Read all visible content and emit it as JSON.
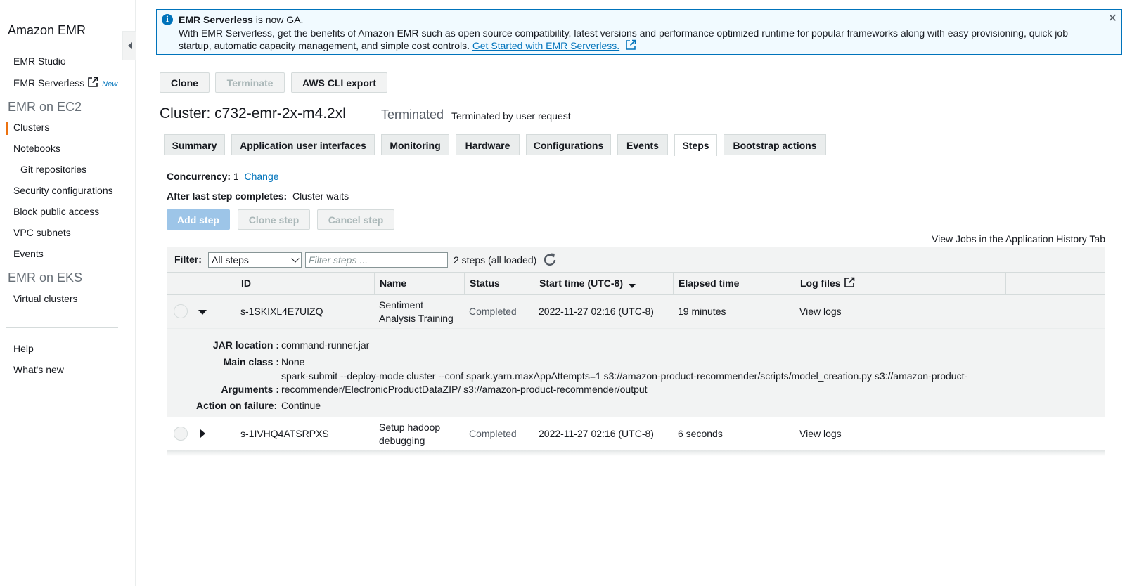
{
  "sidebar": {
    "title": "Amazon EMR",
    "collapse_icon": "caret-left-icon",
    "top_items": [
      {
        "label": "EMR Studio"
      },
      {
        "label": "EMR Serverless",
        "badge": "New"
      }
    ],
    "sections": [
      {
        "label": "EMR on EC2"
      },
      {
        "label": "EMR on EKS"
      }
    ],
    "ec2_items": [
      {
        "label": "Clusters",
        "active": true
      },
      {
        "label": "Notebooks"
      },
      {
        "label": "Git repositories"
      },
      {
        "label": "Security configurations"
      },
      {
        "label": "Block public access"
      },
      {
        "label": "VPC subnets"
      },
      {
        "label": "Events"
      }
    ],
    "eks_items": [
      {
        "label": "Virtual clusters"
      }
    ],
    "bottom_items": [
      {
        "label": "Help"
      },
      {
        "label": "What's new"
      }
    ],
    "active_color": "#ec7211"
  },
  "banner": {
    "title": "EMR Serverless",
    "title_suffix": " is now GA.",
    "body": "With EMR Serverless, get the benefits of Amazon EMR such as open source compatibility, latest versions and performance optimized runtime for popular frameworks along with easy provisioning, quick job startup, automatic capacity management, and simple cost controls.",
    "link_text": "Get Started with EMR Serverless.",
    "close": "✕",
    "info_icon_text": "i"
  },
  "actions": {
    "clone": "Clone",
    "terminate": "Terminate",
    "cli_export": "AWS CLI export"
  },
  "cluster": {
    "title": "Cluster: c732-emr-2x-m4.2xl",
    "state": "Terminated",
    "state_reason": "Terminated by user request"
  },
  "tabs": [
    {
      "label": "Summary"
    },
    {
      "label": "Application user interfaces"
    },
    {
      "label": "Monitoring"
    },
    {
      "label": "Hardware"
    },
    {
      "label": "Configurations"
    },
    {
      "label": "Events"
    },
    {
      "label": "Steps",
      "active": true
    },
    {
      "label": "Bootstrap actions"
    }
  ],
  "steps": {
    "concurrency_label": "Concurrency:",
    "concurrency_value": "1",
    "change_link": "Change",
    "after_label": "After last step completes:",
    "after_value": "Cluster waits",
    "add_step": "Add step",
    "clone_step": "Clone step",
    "cancel_step": "Cancel step",
    "view_jobs": "View Jobs in the Application History Tab",
    "filter_label": "Filter:",
    "filter_value": "All steps",
    "filter_placeholder": "Filter steps ...",
    "count": "2 steps (all loaded)",
    "columns": [
      "ID",
      "Name",
      "Status",
      "Start time (UTC-8)",
      "Elapsed time",
      "Log files"
    ],
    "rows": [
      {
        "id": "s-1SKIXL4E7UIZQ",
        "name_line1": "Sentiment",
        "name_line2": "Analysis Training",
        "status": "Completed",
        "start": "2022-11-27 02:16 (UTC-8)",
        "elapsed": "19 minutes",
        "log": "View logs"
      },
      {
        "id": "s-1IVHQ4ATSRPXS",
        "name_line1": "Setup hadoop",
        "name_line2": "debugging",
        "status": "Completed",
        "start": "2022-11-27 02:16 (UTC-8)",
        "elapsed": "6 seconds",
        "log": "View logs"
      }
    ],
    "details": {
      "jar_label": "JAR location :",
      "jar_value": "command-runner.jar",
      "main_label": "Main class :",
      "main_value": "None",
      "args_label": "Arguments :",
      "args_line1": "spark-submit --deploy-mode cluster --conf spark.yarn.maxAppAttempts=1 s3://amazon-product-recommender/scripts/model_creation.py s3://amazon-product-",
      "args_line2": "recommender/ElectronicProductDataZIP/ s3://amazon-product-recommender/output",
      "failure_label": "Action on failure:",
      "failure_value": "Continue"
    }
  },
  "colors": {
    "link": "#0073bb",
    "primary_disabled": "#9dc5e8"
  }
}
